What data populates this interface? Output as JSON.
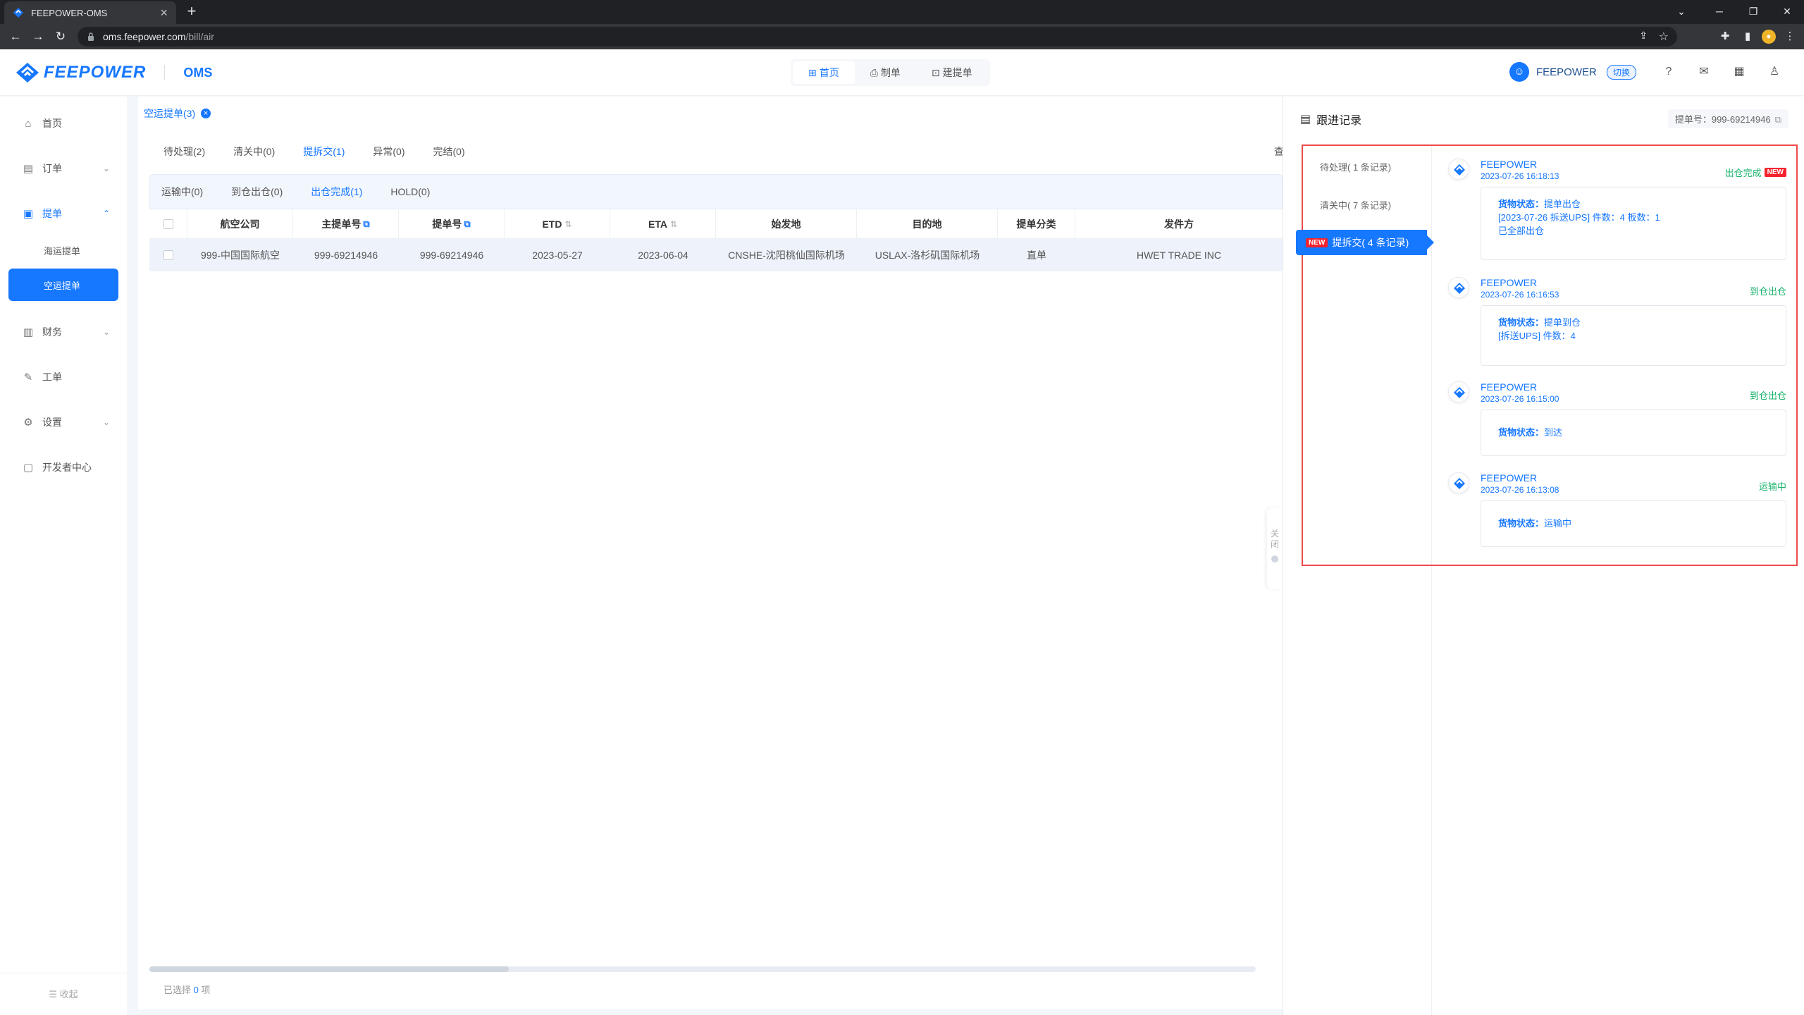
{
  "browser": {
    "tab_title": "FEEPOWER-OMS",
    "url_host": "oms.feepower.com",
    "url_path": "/bill/air"
  },
  "header": {
    "brand": "FEEPOWER",
    "product": "OMS",
    "nav": [
      {
        "label": "首页",
        "icon": "grid-icon",
        "active": true
      },
      {
        "label": "制单",
        "icon": "stamp-icon",
        "active": false
      },
      {
        "label": "建提单",
        "icon": "add-doc-icon",
        "active": false
      }
    ],
    "user_name": "FEEPOWER",
    "switch_label": "切换"
  },
  "sidebar": {
    "items": [
      {
        "label": "首页",
        "icon": "home-icon"
      },
      {
        "label": "订单",
        "icon": "order-icon"
      },
      {
        "label": "提单",
        "icon": "bill-icon"
      },
      {
        "label": "海运提单"
      },
      {
        "label": "空运提单"
      },
      {
        "label": "财务",
        "icon": "finance-icon"
      },
      {
        "label": "工单",
        "icon": "ticket-icon"
      },
      {
        "label": "设置",
        "icon": "settings-icon"
      },
      {
        "label": "开发者中心",
        "icon": "developer-icon"
      }
    ],
    "collapse_label": "收起"
  },
  "main": {
    "page_tab": "空运提单(3)",
    "status_tabs": [
      "待处理(2)",
      "清关中(0)",
      "提拆交(1)",
      "异常(0)",
      "完结(0)"
    ],
    "status_tabs_truncated": "查",
    "sub_tabs": [
      "运输中(0)",
      "到仓出仓(0)",
      "出仓完成(1)",
      "HOLD(0)"
    ],
    "columns": [
      "航空公司",
      "主提单号",
      "提单号",
      "ETD",
      "ETA",
      "始发地",
      "目的地",
      "提单分类",
      "发件方"
    ],
    "rows": [
      [
        "999-中国国际航空",
        "999-69214946",
        "999-69214946",
        "2023-05-27",
        "2023-06-04",
        "CNSHE-沈阳桃仙国际机场",
        "USLAX-洛杉矶国际机场",
        "直单",
        "HWET TRADE INC"
      ]
    ],
    "selected_prefix": "已选择",
    "selected_count": "0",
    "selected_suffix": "项"
  },
  "panel": {
    "title": "跟进记录",
    "bill_no": "提单号：999-69214946",
    "handle_label": "关闭",
    "stages": [
      "待处理( 1 条记录)",
      "清关中( 7 条记录)",
      "提拆交( 4 条记录)"
    ],
    "new_badge": "NEW",
    "records": [
      {
        "org": "FEEPOWER",
        "time": "2023-07-26 16:18:13",
        "status": "出仓完成",
        "new": "NEW",
        "label": "货物状态：",
        "value": "提单出仓",
        "line2": "[2023-07-26 拆送UPS] 件数：4 板数：1",
        "line3": "已全部出仓"
      },
      {
        "org": "FEEPOWER",
        "time": "2023-07-26 16:16:53",
        "status": "到仓出仓",
        "label": "货物状态：",
        "value": "提单到仓",
        "line2": "[拆送UPS] 件数：4"
      },
      {
        "org": "FEEPOWER",
        "time": "2023-07-26 16:15:00",
        "status": "到仓出仓",
        "label": "货物状态：",
        "value": "到达"
      },
      {
        "org": "FEEPOWER",
        "time": "2023-07-26 16:13:08",
        "status": "运输中",
        "label": "货物状态：",
        "value": "运输中"
      }
    ]
  },
  "colors": {
    "primary": "#1677ff",
    "success": "#17b26a",
    "highlight_border": "#f04a4a",
    "new_badge": "#f5222d"
  }
}
